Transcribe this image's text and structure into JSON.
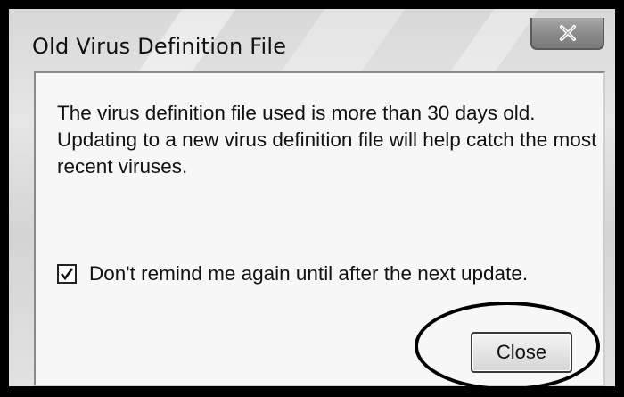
{
  "dialog": {
    "title": "Old Virus Definition File",
    "message": "The virus definition file used is more than 30 days old. Updating to a new virus definition file will help catch the most recent viruses.",
    "checkbox": {
      "label": "Don't remind me again until after the next update.",
      "checked": true
    },
    "close_button_label": "Close",
    "title_close_icon": "close-x-icon"
  }
}
